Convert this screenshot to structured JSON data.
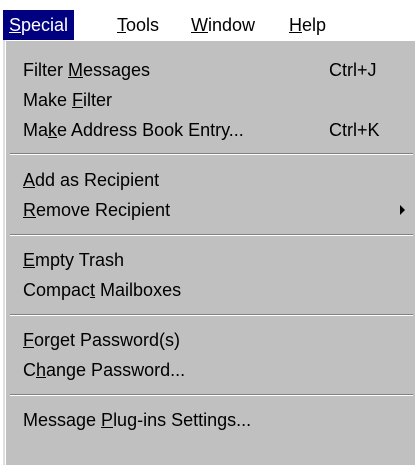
{
  "menubar": {
    "items": [
      {
        "before": "",
        "key": "S",
        "after": "pecial"
      },
      {
        "before": "",
        "key": "T",
        "after": "ools"
      },
      {
        "before": "",
        "key": "W",
        "after": "indow"
      },
      {
        "before": "",
        "key": "H",
        "after": "elp"
      }
    ]
  },
  "menu": {
    "filter_messages": {
      "before": "Filter ",
      "key": "M",
      "after": "essages",
      "shortcut": "Ctrl+J"
    },
    "make_filter": {
      "before": "Make ",
      "key": "F",
      "after": "ilter"
    },
    "make_address_book_entry": {
      "before": "Ma",
      "key": "k",
      "after": "e Address Book Entry...",
      "shortcut": "Ctrl+K"
    },
    "add_as_recipient": {
      "before": "",
      "key": "A",
      "after": "dd as Recipient"
    },
    "remove_recipient": {
      "before": "",
      "key": "R",
      "after": "emove Recipient"
    },
    "empty_trash": {
      "before": "",
      "key": "E",
      "after": "mpty Trash"
    },
    "compact_mailboxes": {
      "before": "Compac",
      "key": "t",
      "after": " Mailboxes"
    },
    "forget_password": {
      "before": "",
      "key": "F",
      "after": "orget Password(s)"
    },
    "change_password": {
      "before": "C",
      "key": "h",
      "after": "ange Password..."
    },
    "message_plugins_settings": {
      "before": "Message ",
      "key": "P",
      "after": "lug-ins Settings..."
    }
  }
}
